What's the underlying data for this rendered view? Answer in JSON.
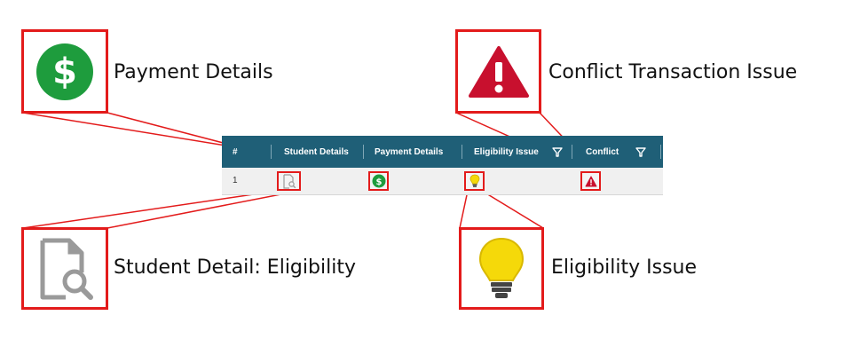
{
  "callouts": {
    "payment_details": {
      "label": "Payment Details",
      "icon": "dollar-circle-icon"
    },
    "conflict_issue": {
      "label": "Conflict Transaction Issue",
      "icon": "warning-triangle-icon"
    },
    "student_detail": {
      "label": "Student Detail: Eligibility",
      "icon": "document-search-icon"
    },
    "eligibility_issue": {
      "label": "Eligibility Issue",
      "icon": "lightbulb-icon"
    }
  },
  "table": {
    "columns": [
      "#",
      "Student Details",
      "Payment Details",
      "Eligibility Issue",
      "Conflict"
    ],
    "rows": [
      {
        "index": "1"
      }
    ]
  },
  "colors": {
    "callout_red": "#e31b1b",
    "header_teal": "#1f5f77",
    "dollar_green": "#1e9c3d",
    "warning_red": "#c8102e",
    "bulb_yellow": "#f5d90a"
  }
}
